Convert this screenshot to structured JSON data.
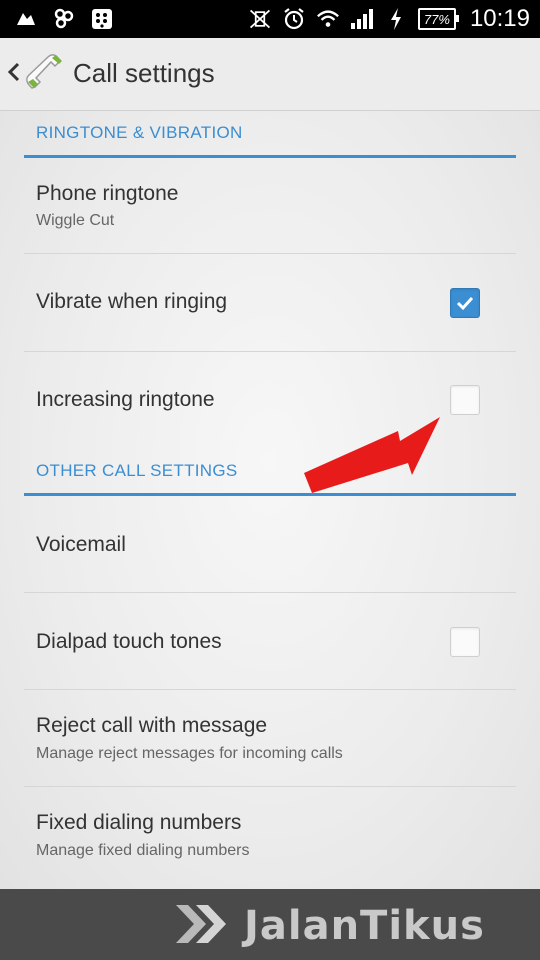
{
  "status_bar": {
    "left_icons": [
      "recycle-icon",
      "bbm-icon",
      "blackberry-icon"
    ],
    "right_icons": [
      "no-vibrate-icon",
      "alarm-icon",
      "wifi-icon",
      "signal-icon",
      "charging-icon"
    ],
    "battery": "77%",
    "time": "10:19"
  },
  "action_bar": {
    "title": "Call settings"
  },
  "sections": [
    {
      "header": "RINGTONE & VIBRATION"
    },
    {
      "header": "OTHER CALL SETTINGS"
    }
  ],
  "rows": {
    "phone_ringtone": {
      "title": "Phone ringtone",
      "subtitle": "Wiggle Cut"
    },
    "vibrate_when_ringing": {
      "title": "Vibrate when ringing",
      "checked": true
    },
    "increasing_ringtone": {
      "title": "Increasing ringtone",
      "checked": false
    },
    "voicemail": {
      "title": "Voicemail"
    },
    "dialpad_touch_tones": {
      "title": "Dialpad touch tones",
      "checked": false
    },
    "reject_call": {
      "title": "Reject call with message",
      "subtitle": "Manage reject messages for incoming calls"
    },
    "fixed_dialing": {
      "title": "Fixed dialing numbers",
      "subtitle": "Manage fixed dialing numbers"
    }
  },
  "watermark": {
    "brand": "JalanTikus"
  },
  "colors": {
    "accent": "#3b8ed1",
    "arrow": "#e81b1b",
    "bottom_bar": "#4a4a4a"
  }
}
